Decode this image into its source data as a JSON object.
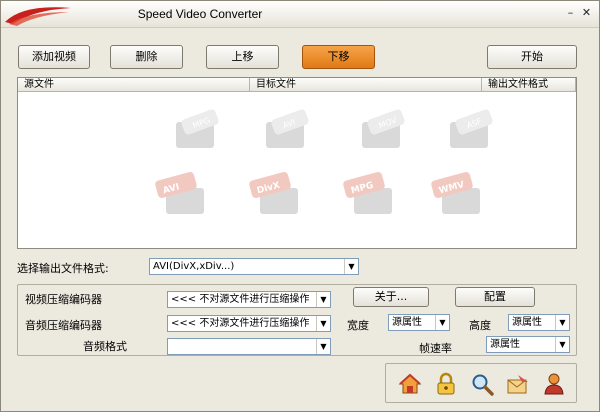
{
  "window": {
    "title": "Speed Video Converter",
    "minimize": "–",
    "close": "✕"
  },
  "toolbar": {
    "add_video": "添加视频",
    "delete": "删除",
    "move_up": "上移",
    "move_down": "下移",
    "start": "开始"
  },
  "table": {
    "columns": [
      "源文件",
      "目标文件",
      "输出文件格式"
    ]
  },
  "watermark_formats": [
    "MPG",
    "AVI",
    "MOV",
    "ASF",
    "AVI",
    "DivX",
    "MPG",
    "WMV"
  ],
  "output_format": {
    "label": "选择输出文件格式:",
    "value": "AVI(DivX,xDiv...)"
  },
  "codec": {
    "video_label": "视频压缩编码器",
    "video_value": "<<< 不对源文件进行压缩操作",
    "audio_label": "音频压缩编码器",
    "audio_value": "<<< 不对源文件进行压缩操作",
    "audio_format_label": "音频格式",
    "audio_format_value": "",
    "about_button": "关于...",
    "config_button": "配置",
    "width_label": "宽度",
    "width_value": "源属性",
    "height_label": "高度",
    "height_value": "源属性",
    "framerate_label": "帧速率",
    "framerate_value": "源属性"
  },
  "bottom_icons": [
    "home-icon",
    "lock-icon",
    "magnifier-icon",
    "email-icon",
    "help-person-icon"
  ],
  "colors": {
    "accent_orange": "#f08c28",
    "brand_red": "#c8201c"
  }
}
